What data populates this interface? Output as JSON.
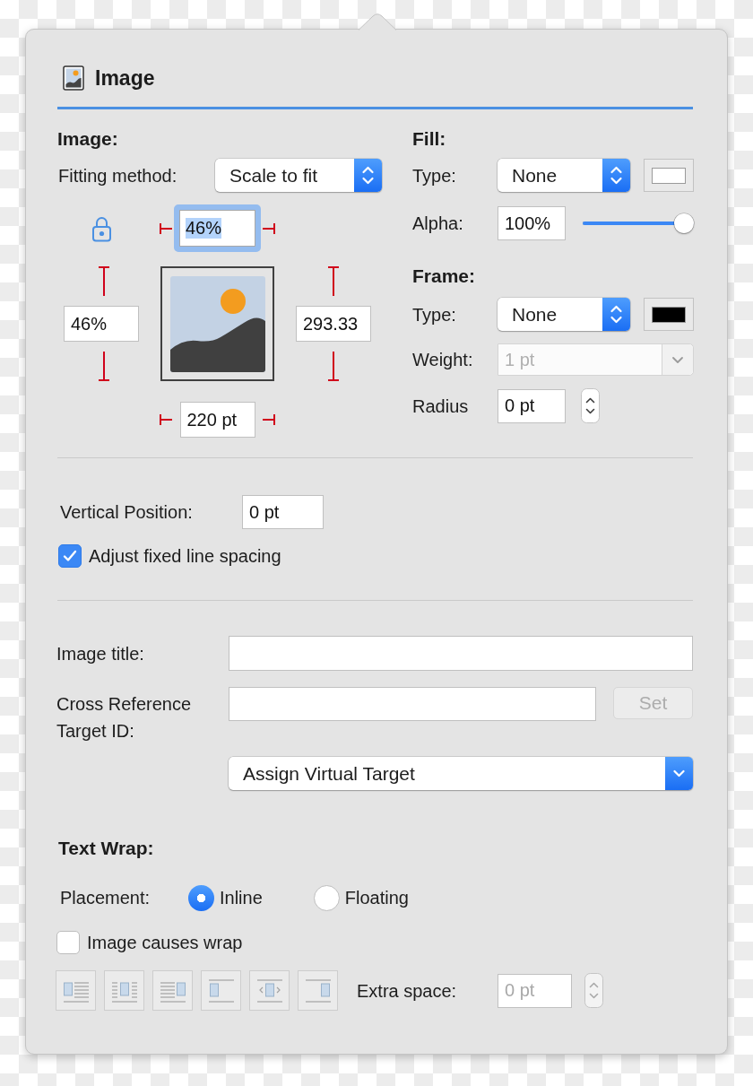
{
  "header": {
    "title": "Image"
  },
  "image": {
    "heading": "Image:",
    "fitting_method": {
      "label": "Fitting method:",
      "value": "Scale to fit"
    },
    "top_field": {
      "value": "46%",
      "focused": true
    },
    "left_field": {
      "value": "46%",
      "focused": false
    },
    "right_field": {
      "value": "293.33",
      "focused": false
    },
    "bottom_field": {
      "value": "220 pt",
      "focused": false
    }
  },
  "fill": {
    "heading": "Fill:",
    "type": {
      "label": "Type:",
      "value": "None"
    },
    "color": "#ffffff",
    "alpha": {
      "label": "Alpha:",
      "value": "100%",
      "level": 1
    }
  },
  "frame": {
    "heading": "Frame:",
    "type": {
      "label": "Type:",
      "value": "None"
    },
    "color": "#000000",
    "weight": {
      "label": "Weight:",
      "value": "1 pt",
      "disabled": true
    },
    "radius": {
      "label": "Radius",
      "value": "0 pt"
    }
  },
  "vertical_position": {
    "label": "Vertical Position:",
    "value": "0 pt"
  },
  "adjust_line_spacing": {
    "label": "Adjust fixed line spacing",
    "checked": true
  },
  "image_title": {
    "label": "Image title:"
  },
  "cross_reference": {
    "label": "Cross Reference Target ID:",
    "button": {
      "label": "Set",
      "disabled": true
    }
  },
  "virtual_target": {
    "value": "Assign Virtual Target"
  },
  "text_wrap": {
    "heading": "Text Wrap:",
    "placement": {
      "label": "Placement:",
      "options": [
        {
          "label": "Inline",
          "selected": true
        },
        {
          "label": "Floating",
          "selected": false
        }
      ]
    },
    "causes_wrap": {
      "label": "Image causes wrap",
      "checked": false
    },
    "wrap_styles": [
      {
        "kind": "square-left",
        "disabled": true
      },
      {
        "kind": "square-center",
        "disabled": true
      },
      {
        "kind": "square-right",
        "disabled": true
      },
      {
        "kind": "top-bottom-left",
        "disabled": true
      },
      {
        "kind": "top-bottom-center",
        "disabled": true
      },
      {
        "kind": "top-bottom-right",
        "disabled": true
      }
    ],
    "extra_space": {
      "label": "Extra space:",
      "value": "0 pt",
      "disabled": true
    }
  }
}
